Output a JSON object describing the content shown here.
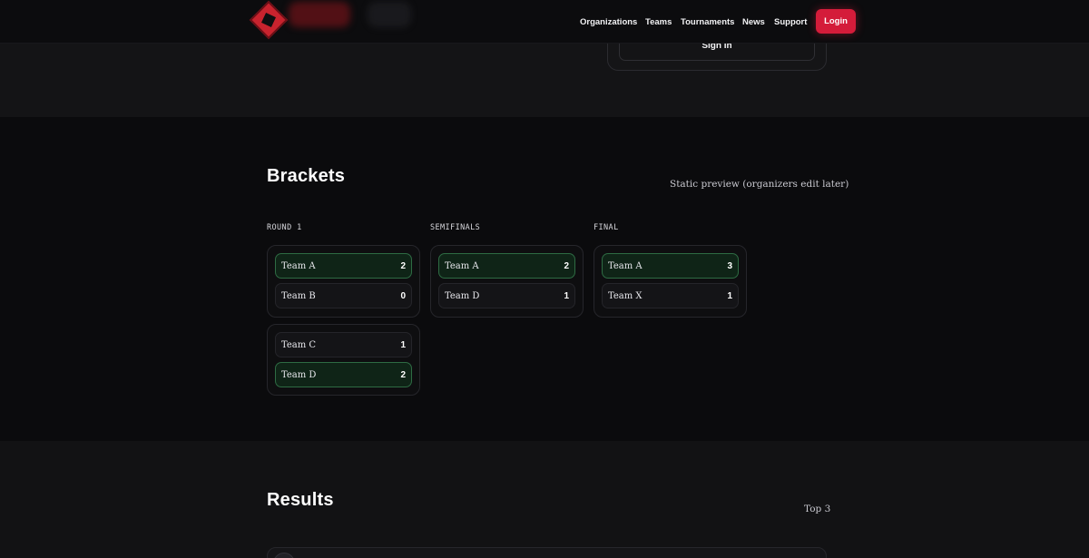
{
  "header": {
    "nav": [
      "Organizations",
      "Teams",
      "Tournaments",
      "News",
      "Support"
    ],
    "login_label": "Login"
  },
  "hero": {
    "signin_label": "Sign In"
  },
  "brackets": {
    "title": "Brackets",
    "meta": "Static preview (organizers edit later)",
    "rounds": [
      {
        "label": "ROUND 1",
        "matches": [
          {
            "teams": [
              {
                "name": "Team A",
                "score": "2",
                "winner": true
              },
              {
                "name": "Team B",
                "score": "0",
                "winner": false
              }
            ]
          },
          {
            "teams": [
              {
                "name": "Team C",
                "score": "1",
                "winner": false
              },
              {
                "name": "Team D",
                "score": "2",
                "winner": true
              }
            ]
          }
        ]
      },
      {
        "label": "SEMIFINALS",
        "matches": [
          {
            "teams": [
              {
                "name": "Team A",
                "score": "2",
                "winner": true
              },
              {
                "name": "Team D",
                "score": "1",
                "winner": false
              }
            ]
          }
        ]
      },
      {
        "label": "FINAL",
        "matches": [
          {
            "teams": [
              {
                "name": "Team A",
                "score": "3",
                "winner": true
              },
              {
                "name": "Team X",
                "score": "1",
                "winner": false
              }
            ]
          }
        ]
      }
    ]
  },
  "results": {
    "title": "Results",
    "meta": "Top 3"
  },
  "colors": {
    "accent": "#d41c3a",
    "winner_bg": "#0f2417",
    "winner_border": "#2e6b43",
    "background": "#0b0b0d"
  }
}
